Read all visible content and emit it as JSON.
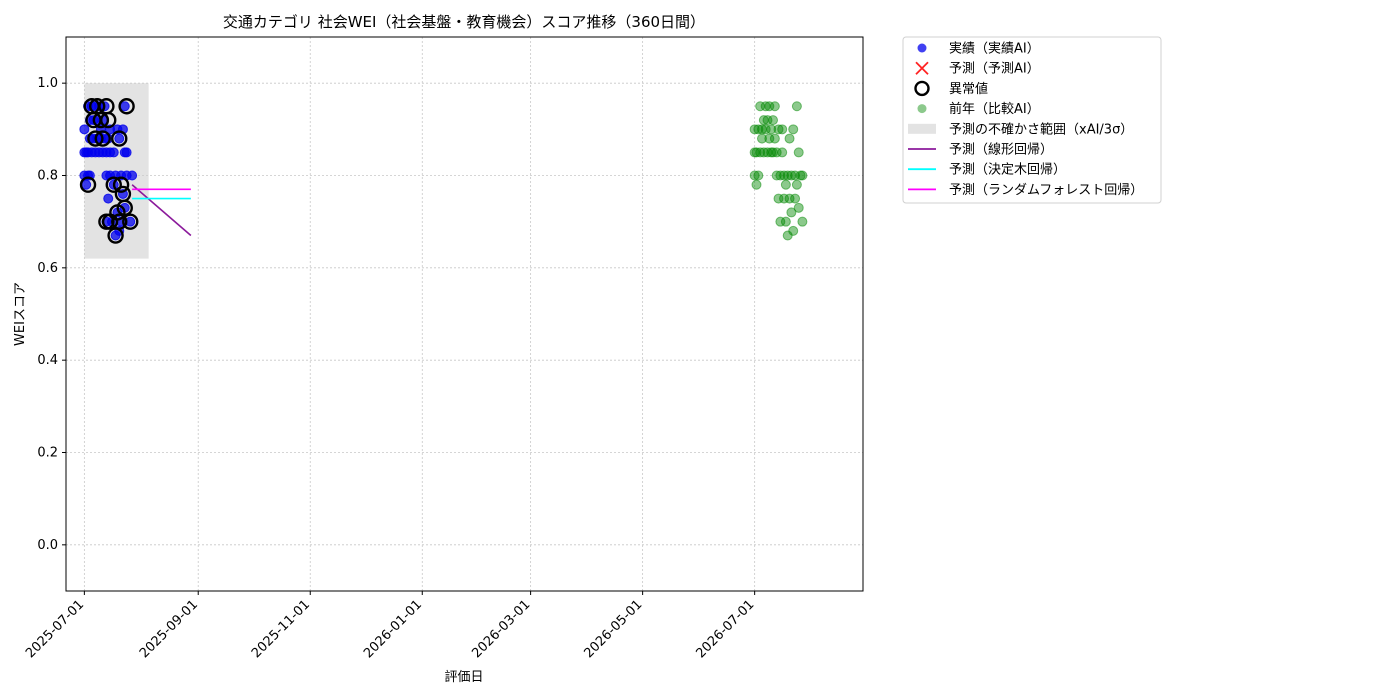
{
  "chart_data": {
    "type": "scatter",
    "title": "交通カテゴリ 社会WEI（社会基盤・教育機会）スコア推移（360日間）",
    "xlabel": "評価日",
    "ylabel": "WEIスコア",
    "x_type": "date",
    "xlim": [
      "2025-06-21",
      "2026-08-29"
    ],
    "ylim": [
      -0.1,
      1.1
    ],
    "y_ticks": [
      0.0,
      0.2,
      0.4,
      0.6,
      0.8,
      1.0
    ],
    "y_tick_labels": [
      "0.0",
      "0.2",
      "0.4",
      "0.6",
      "0.8",
      "1.0"
    ],
    "x_ticks": [
      "2025-07-01",
      "2025-09-01",
      "2025-11-01",
      "2026-01-01",
      "2026-03-01",
      "2026-05-01",
      "2026-07-01"
    ],
    "grid": true,
    "legend_position": "outside-right-top",
    "colors": {
      "actual": "#0000ee",
      "predicted": "#ff2222",
      "anomaly": "#000000",
      "previous_year": "#008800",
      "uncertainty": "#cccccc",
      "linear": "#8b1a9b",
      "tree": "#00ffff",
      "forest": "#ff00ff"
    },
    "legend": [
      {
        "label": "実績（実績AI）",
        "marker": "dot",
        "color_key": "actual"
      },
      {
        "label": "予測（予測AI）",
        "marker": "x",
        "color_key": "predicted"
      },
      {
        "label": "異常値",
        "marker": "ring",
        "color_key": "anomaly"
      },
      {
        "label": "前年（比較AI）",
        "marker": "dot-faded",
        "color_key": "previous_year"
      },
      {
        "label": "予測の不確かさ範囲（xAI/3σ）",
        "marker": "box",
        "color_key": "uncertainty"
      },
      {
        "label": "予測（線形回帰）",
        "marker": "line",
        "color_key": "linear"
      },
      {
        "label": "予測（決定木回帰）",
        "marker": "line",
        "color_key": "tree"
      },
      {
        "label": "予測（ランダムフォレスト回帰）",
        "marker": "line",
        "color_key": "forest"
      }
    ],
    "uncertainty_band": {
      "x": [
        "2025-07-01",
        "2025-08-05"
      ],
      "y": [
        0.62,
        1.0
      ]
    },
    "actual": [
      [
        "2025-07-01",
        0.9
      ],
      [
        "2025-07-01",
        0.85
      ],
      [
        "2025-07-01",
        0.8
      ],
      [
        "2025-07-02",
        0.78
      ],
      [
        "2025-07-02",
        0.85
      ],
      [
        "2025-07-03",
        0.8
      ],
      [
        "2025-07-03",
        0.95
      ],
      [
        "2025-07-03",
        0.85
      ],
      [
        "2025-07-04",
        0.92
      ],
      [
        "2025-07-04",
        0.88
      ],
      [
        "2025-07-04",
        0.8
      ],
      [
        "2025-07-05",
        0.95
      ],
      [
        "2025-07-05",
        0.85
      ],
      [
        "2025-07-06",
        0.92
      ],
      [
        "2025-07-06",
        0.88
      ],
      [
        "2025-07-07",
        0.95
      ],
      [
        "2025-07-07",
        0.85
      ],
      [
        "2025-07-08",
        0.88
      ],
      [
        "2025-07-08",
        0.92
      ],
      [
        "2025-07-09",
        0.95
      ],
      [
        "2025-07-09",
        0.85
      ],
      [
        "2025-07-10",
        0.9
      ],
      [
        "2025-07-10",
        0.88
      ],
      [
        "2025-07-11",
        0.92
      ],
      [
        "2025-07-11",
        0.85
      ],
      [
        "2025-07-12",
        0.95
      ],
      [
        "2025-07-12",
        0.88
      ],
      [
        "2025-07-13",
        0.8
      ],
      [
        "2025-07-13",
        0.85
      ],
      [
        "2025-07-13",
        0.7
      ],
      [
        "2025-07-14",
        0.88
      ],
      [
        "2025-07-14",
        0.75
      ],
      [
        "2025-07-15",
        0.9
      ],
      [
        "2025-07-15",
        0.8
      ],
      [
        "2025-07-15",
        0.85
      ],
      [
        "2025-07-16",
        0.7
      ],
      [
        "2025-07-17",
        0.78
      ],
      [
        "2025-07-17",
        0.85
      ],
      [
        "2025-07-18",
        0.67
      ],
      [
        "2025-07-18",
        0.8
      ],
      [
        "2025-07-19",
        0.72
      ],
      [
        "2025-07-19",
        0.9
      ],
      [
        "2025-07-20",
        0.88
      ],
      [
        "2025-07-20",
        0.68
      ],
      [
        "2025-07-21",
        0.8
      ],
      [
        "2025-07-21",
        0.7
      ],
      [
        "2025-07-22",
        0.76
      ],
      [
        "2025-07-22",
        0.9
      ],
      [
        "2025-07-23",
        0.95
      ],
      [
        "2025-07-23",
        0.85
      ],
      [
        "2025-07-23",
        0.73
      ],
      [
        "2025-07-24",
        0.8
      ],
      [
        "2025-07-24",
        0.85
      ],
      [
        "2025-07-26",
        0.7
      ],
      [
        "2025-07-27",
        0.8
      ]
    ],
    "anomalies": [
      [
        "2025-07-03",
        0.78
      ],
      [
        "2025-07-05",
        0.95
      ],
      [
        "2025-07-06",
        0.92
      ],
      [
        "2025-07-07",
        0.88
      ],
      [
        "2025-07-08",
        0.95
      ],
      [
        "2025-07-10",
        0.92
      ],
      [
        "2025-07-11",
        0.88
      ],
      [
        "2025-07-13",
        0.95
      ],
      [
        "2025-07-13",
        0.7
      ],
      [
        "2025-07-14",
        0.92
      ],
      [
        "2025-07-15",
        0.7
      ],
      [
        "2025-07-17",
        0.78
      ],
      [
        "2025-07-18",
        0.67
      ],
      [
        "2025-07-19",
        0.72
      ],
      [
        "2025-07-20",
        0.7
      ],
      [
        "2025-07-20",
        0.88
      ],
      [
        "2025-07-21",
        0.78
      ],
      [
        "2025-07-22",
        0.76
      ],
      [
        "2025-07-23",
        0.73
      ],
      [
        "2025-07-24",
        0.95
      ],
      [
        "2025-07-26",
        0.7
      ]
    ],
    "previous_year": [
      [
        "2026-07-01",
        0.9
      ],
      [
        "2026-07-01",
        0.85
      ],
      [
        "2026-07-01",
        0.8
      ],
      [
        "2026-07-02",
        0.78
      ],
      [
        "2026-07-02",
        0.85
      ],
      [
        "2026-07-03",
        0.9
      ],
      [
        "2026-07-03",
        0.8
      ],
      [
        "2026-07-04",
        0.85
      ],
      [
        "2026-07-04",
        0.95
      ],
      [
        "2026-07-05",
        0.9
      ],
      [
        "2026-07-05",
        0.88
      ],
      [
        "2026-07-06",
        0.92
      ],
      [
        "2026-07-06",
        0.85
      ],
      [
        "2026-07-07",
        0.95
      ],
      [
        "2026-07-07",
        0.9
      ],
      [
        "2026-07-08",
        0.85
      ],
      [
        "2026-07-08",
        0.92
      ],
      [
        "2026-07-09",
        0.95
      ],
      [
        "2026-07-09",
        0.88
      ],
      [
        "2026-07-10",
        0.9
      ],
      [
        "2026-07-10",
        0.85
      ],
      [
        "2026-07-11",
        0.92
      ],
      [
        "2026-07-11",
        0.85
      ],
      [
        "2026-07-12",
        0.95
      ],
      [
        "2026-07-12",
        0.88
      ],
      [
        "2026-07-13",
        0.8
      ],
      [
        "2026-07-13",
        0.85
      ],
      [
        "2026-07-14",
        0.9
      ],
      [
        "2026-07-14",
        0.75
      ],
      [
        "2026-07-15",
        0.8
      ],
      [
        "2026-07-15",
        0.7
      ],
      [
        "2026-07-16",
        0.85
      ],
      [
        "2026-07-16",
        0.9
      ],
      [
        "2026-07-17",
        0.8
      ],
      [
        "2026-07-17",
        0.75
      ],
      [
        "2026-07-18",
        0.78
      ],
      [
        "2026-07-18",
        0.7
      ],
      [
        "2026-07-19",
        0.67
      ],
      [
        "2026-07-19",
        0.8
      ],
      [
        "2026-07-20",
        0.88
      ],
      [
        "2026-07-20",
        0.75
      ],
      [
        "2026-07-21",
        0.72
      ],
      [
        "2026-07-21",
        0.8
      ],
      [
        "2026-07-22",
        0.9
      ],
      [
        "2026-07-22",
        0.68
      ],
      [
        "2026-07-23",
        0.75
      ],
      [
        "2026-07-23",
        0.8
      ],
      [
        "2026-07-24",
        0.95
      ],
      [
        "2026-07-24",
        0.78
      ],
      [
        "2026-07-25",
        0.85
      ],
      [
        "2026-07-25",
        0.73
      ],
      [
        "2026-07-26",
        0.8
      ],
      [
        "2026-07-27",
        0.7
      ],
      [
        "2026-07-27",
        0.8
      ]
    ],
    "prediction_lines": [
      {
        "key": "linear",
        "points": [
          [
            "2025-07-27",
            0.78
          ],
          [
            "2025-08-28",
            0.67
          ]
        ]
      },
      {
        "key": "tree",
        "points": [
          [
            "2025-07-27",
            0.75
          ],
          [
            "2025-08-28",
            0.75
          ]
        ]
      },
      {
        "key": "forest",
        "points": [
          [
            "2025-07-27",
            0.77
          ],
          [
            "2025-08-28",
            0.77
          ]
        ]
      }
    ]
  }
}
